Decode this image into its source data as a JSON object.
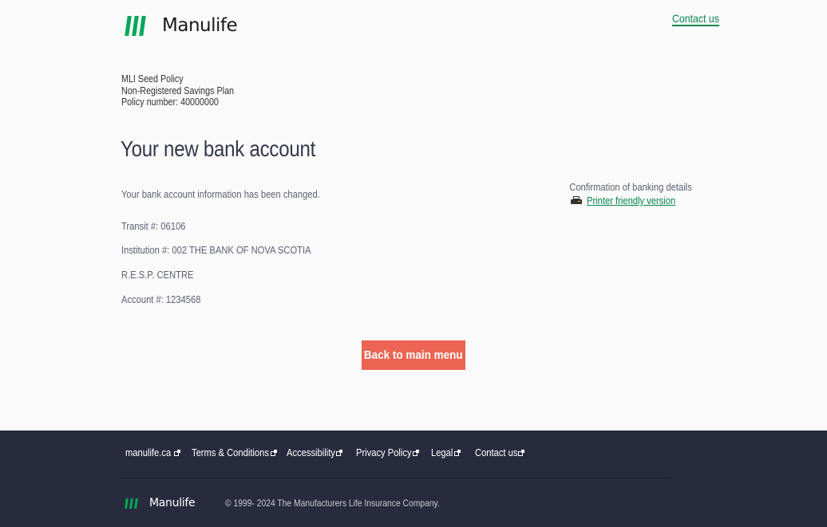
{
  "header": {
    "brand": "Manulife",
    "contact_link": "Contact us"
  },
  "policy": {
    "name": "MLI Seed Policy",
    "plan": "Non-Registered Savings Plan",
    "number_line": "Policy number: 40000000"
  },
  "main": {
    "title": "Your new bank account",
    "message": "Your bank account information has been changed.",
    "details": {
      "transit": "Transit #: 06106",
      "institution": "Institution #: 002 THE BANK OF NOVA SCOTIA",
      "branch": "R.E.S.P. CENTRE",
      "account": "Account #: 1234568"
    },
    "confirmation": {
      "label": "Confirmation of banking details",
      "printer_link": "Printer friendly version",
      "icon": "printer-icon"
    },
    "back_button": "Back to main menu"
  },
  "footer": {
    "links": [
      {
        "label": "manulife.ca",
        "icon": "external-link-icon"
      },
      {
        "label": "Terms & Conditions",
        "icon": "external-link-icon"
      },
      {
        "label": "Accessibility",
        "icon": "external-link-icon"
      },
      {
        "label": "Privacy Policy",
        "icon": "external-link-icon"
      },
      {
        "label": "Legal",
        "icon": "external-link-icon"
      },
      {
        "label": "Contact us",
        "icon": "external-link-icon"
      }
    ],
    "brand": "Manulife",
    "copyright": "© 1999- 2024 The Manufacturers Life Insurance Company."
  },
  "colors": {
    "brand_green": "#00a758",
    "link_green": "#06874e",
    "button_coral": "#ec6453",
    "footer_bg": "#282b3e"
  }
}
